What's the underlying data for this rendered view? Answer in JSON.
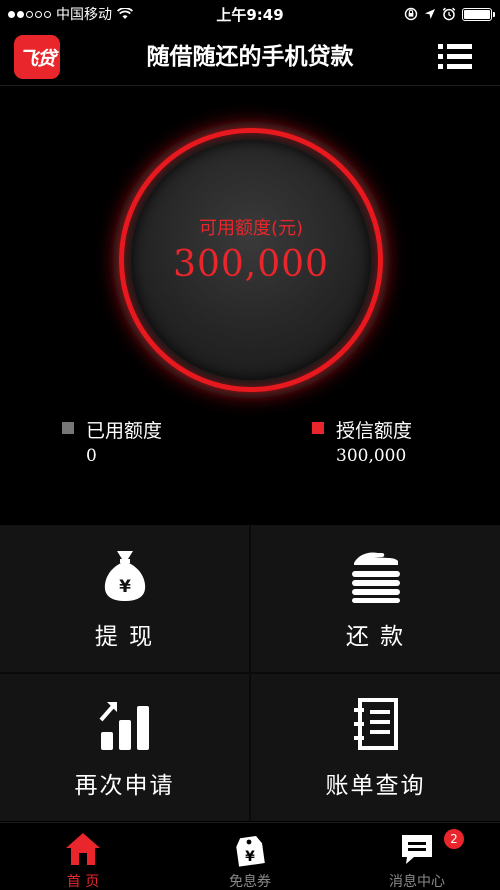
{
  "status_bar": {
    "carrier": "中国移动",
    "time": "上午9:49"
  },
  "header": {
    "logo_text": "飞贷",
    "title": "随借随还的手机贷款",
    "menu_icon": "list-menu-icon"
  },
  "credit": {
    "label": "可用额度(元)",
    "value": "300,000"
  },
  "legend": {
    "used": {
      "label": "已用额度",
      "value": "0",
      "color": "#777777"
    },
    "granted": {
      "label": "授信额度",
      "value": "300,000",
      "color": "#e8262c"
    }
  },
  "actions": [
    {
      "label": "提 现",
      "icon": "money-bag-icon"
    },
    {
      "label": "还 款",
      "icon": "repay-coins-icon"
    },
    {
      "label": "再次申请",
      "icon": "bar-chart-up-icon"
    },
    {
      "label": "账单查询",
      "icon": "ledger-book-icon"
    }
  ],
  "tabs": [
    {
      "label": "首 页",
      "icon": "home-icon",
      "active": true
    },
    {
      "label": "免息券",
      "icon": "coupon-tag-icon",
      "active": false
    },
    {
      "label": "消息中心",
      "icon": "message-icon",
      "active": false,
      "badge": "2"
    }
  ],
  "colors": {
    "accent": "#e8262c",
    "background": "#000000",
    "cell_background": "#141414"
  }
}
